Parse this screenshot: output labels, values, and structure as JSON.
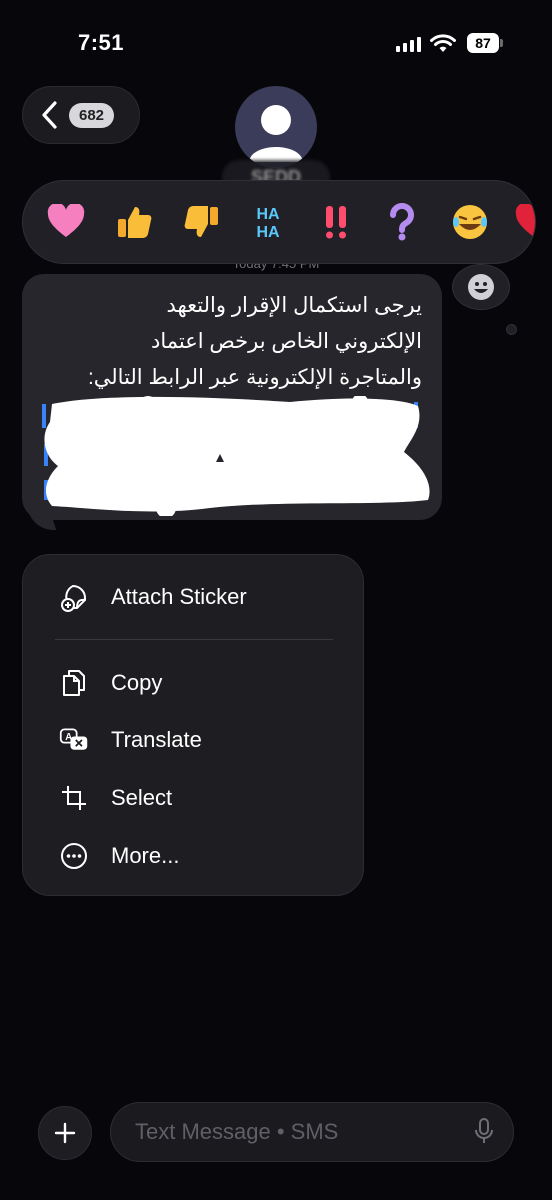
{
  "status": {
    "time": "7:51",
    "battery": "87"
  },
  "header": {
    "back_count": "682",
    "contact_name": "SEDD"
  },
  "thread": {
    "timestamp": "Today 7:45 PM"
  },
  "reactions": [
    "heart",
    "thumbs-up",
    "thumbs-down",
    "haha",
    "double-exclamation",
    "question",
    "laughing",
    "more-heart"
  ],
  "message": {
    "text": "يرجى استكمال الإقرار والتعهد\nالإلكتروني الخاص برخص اعتماد\nوالمتاجرة الإلكترونية عبر الرابط التالي:"
  },
  "menu": {
    "attach_sticker": "Attach Sticker",
    "copy": "Copy",
    "translate": "Translate",
    "select": "Select",
    "more": "More..."
  },
  "composer": {
    "placeholder": "Text Message • SMS"
  },
  "colors": {
    "background": "#06060b",
    "bubble": "#26262c",
    "menu": "#1d1d22",
    "link": "#3a82f7"
  }
}
